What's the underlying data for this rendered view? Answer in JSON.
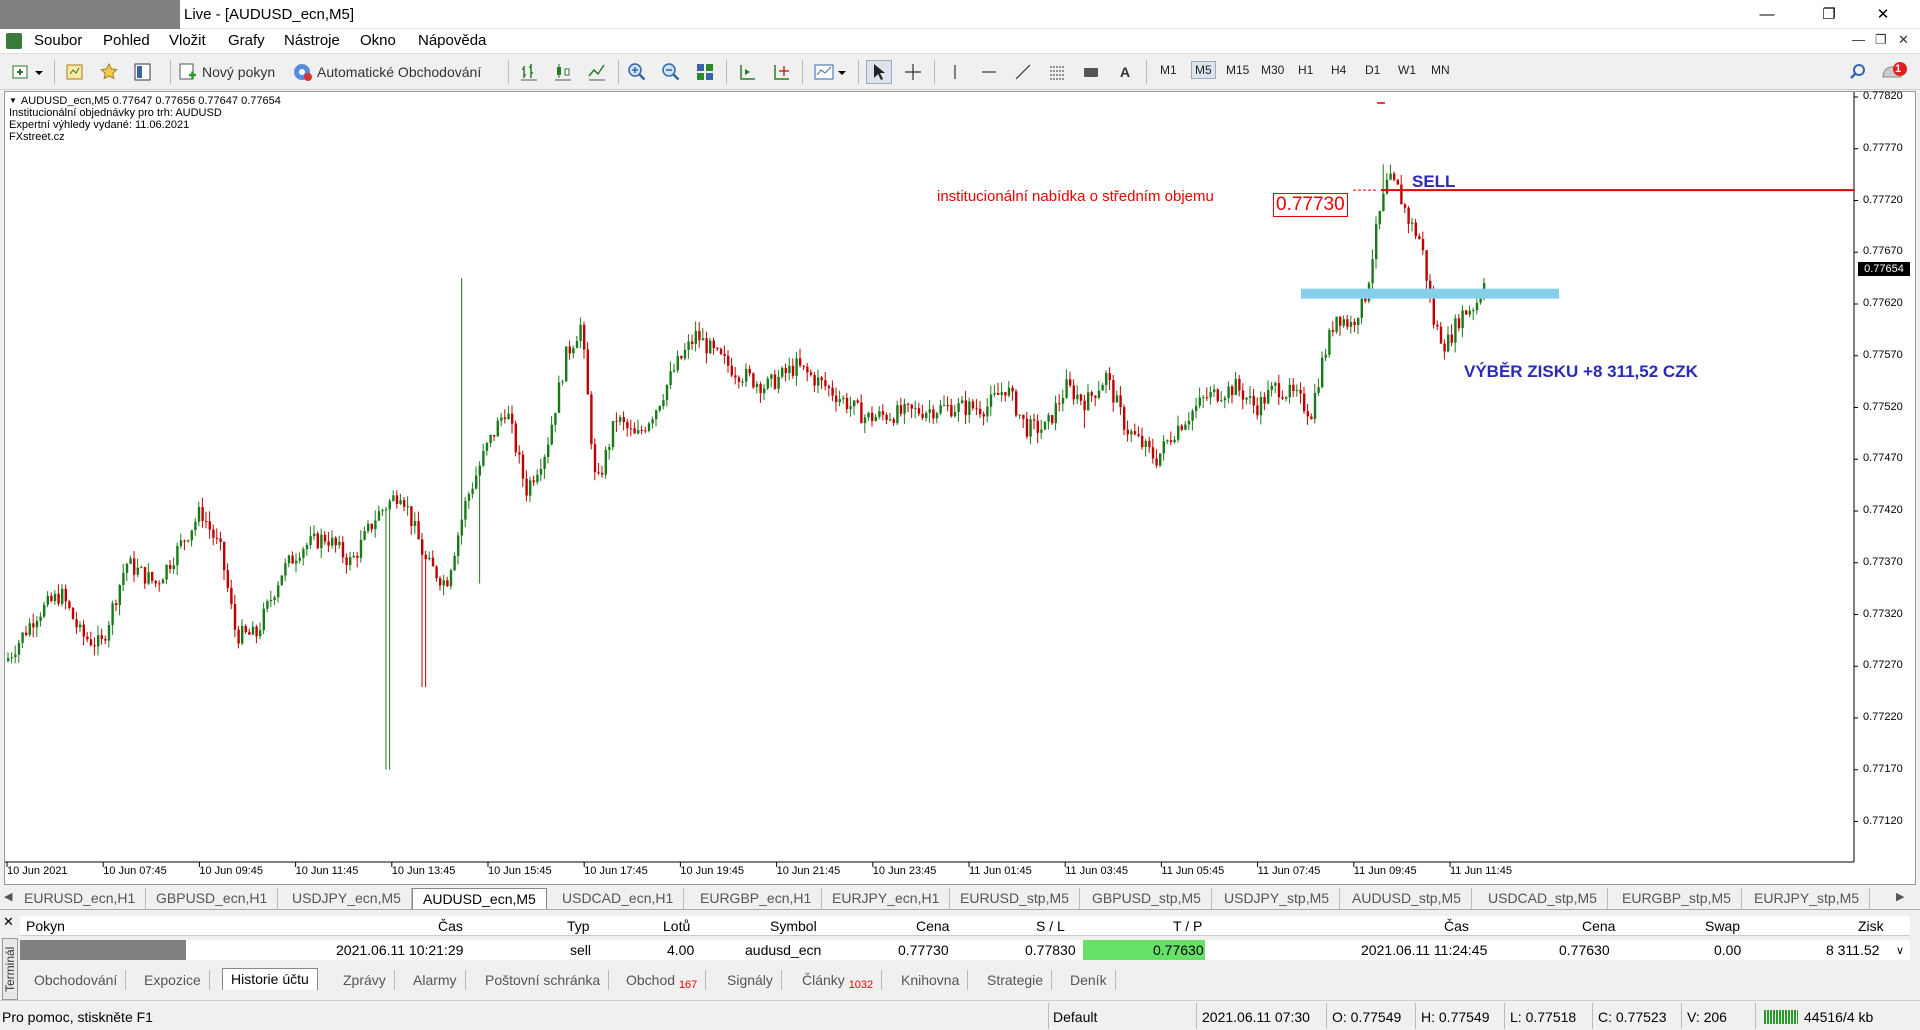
{
  "window": {
    "title": "Live - [AUDUSD_ecn,M5]"
  },
  "menu": [
    "Soubor",
    "Pohled",
    "Vložit",
    "Grafy",
    "Nástroje",
    "Okno",
    "Nápověda"
  ],
  "toolbar": {
    "new_order": "Nový pokyn",
    "auto_trading": "Automatické Obchodování",
    "timeframes": [
      "M1",
      "M5",
      "M15",
      "M30",
      "H1",
      "H4",
      "D1",
      "W1",
      "MN"
    ],
    "active_timeframe": "M5",
    "text_tool": "A",
    "notifications_count": "1"
  },
  "chart": {
    "info_line1": "AUDUSD_ecn,M5  0.77647 0.77656 0.77647 0.77654",
    "info_line2": "Institucionální objednávky pro trh: AUDUSD",
    "info_line3": "Expertní výhledy vydané: 11.06.2021",
    "info_line4": "FXstreet.cz",
    "current_price": "0.77654",
    "y_labels": [
      "0.77820",
      "0.77770",
      "0.77720",
      "0.77670",
      "0.77620",
      "0.77570",
      "0.77520",
      "0.77470",
      "0.77420",
      "0.77370",
      "0.77320",
      "0.77270",
      "0.77220",
      "0.77170",
      "0.77120"
    ],
    "x_labels": [
      "10 Jun 2021",
      "10 Jun 07:45",
      "10 Jun 09:45",
      "10 Jun 11:45",
      "10 Jun 13:45",
      "10 Jun 15:45",
      "10 Jun 17:45",
      "10 Jun 19:45",
      "10 Jun 21:45",
      "10 Jun 23:45",
      "11 Jun 01:45",
      "11 Jun 03:45",
      "11 Jun 05:45",
      "11 Jun 07:45",
      "11 Jun 09:45",
      "11 Jun 11:45"
    ],
    "annotation_offer": "institucionální nabídka o středním objemu",
    "annotation_price": "0.77730",
    "annotation_sell": "SELL",
    "annotation_profit": "VÝBĚR ZISKU +8 311,52 CZK",
    "sell_level": 0.7773,
    "tp_level": 0.7763,
    "colors": {
      "bull": "#1a7a1a",
      "bear": "#c00000",
      "sell_line": "#e00000",
      "tp_line": "#87ceeb"
    }
  },
  "symbol_tabs": [
    "EURUSD_ecn,H1",
    "GBPUSD_ecn,H1",
    "USDJPY_ecn,M5",
    "AUDUSD_ecn,M5",
    "USDCAD_ecn,H1",
    "EURGBP_ecn,H1",
    "EURJPY_ecn,H1",
    "EURUSD_stp,M5",
    "GBPUSD_stp,M5",
    "USDJPY_stp,M5",
    "AUDUSD_stp,M5",
    "USDCAD_stp,M5",
    "EURGBP_stp,M5",
    "EURJPY_stp,M5"
  ],
  "active_symbol_tab": "AUDUSD_ecn,M5",
  "terminal": {
    "label": "Terminál",
    "headers": [
      "Pokyn",
      "Čas",
      "Typ",
      "Lotů",
      "Symbol",
      "Cena",
      "S / L",
      "T / P",
      "Čas",
      "Cena",
      "Swap",
      "Zisk"
    ],
    "row": [
      "",
      "2021.06.11 10:21:29",
      "sell",
      "4.00",
      "audusd_ecn",
      "0.77730",
      "0.77830",
      "0.77630",
      "2021.06.11 11:24:45",
      "0.77630",
      "0.00",
      "8 311.52"
    ],
    "tabs": [
      "Obchodování",
      "Expozice",
      "Historie účtu",
      "Zprávy",
      "Alarmy",
      "Poštovní schránka",
      "Obchod",
      "Signály",
      "Články",
      "Knihovna",
      "Strategie",
      "Deník"
    ],
    "obchod_badge": "167",
    "clanky_badge": "1032",
    "active_tab": "Historie účtu"
  },
  "status": {
    "help": "Pro pomoc, stiskněte F1",
    "profile": "Default",
    "datetime": "2021.06.11 07:30",
    "open": "O: 0.77549",
    "high": "H: 0.77549",
    "low": "L: 0.77518",
    "close": "C: 0.77523",
    "volume": "V: 206",
    "traffic": "44516/4 kb"
  }
}
